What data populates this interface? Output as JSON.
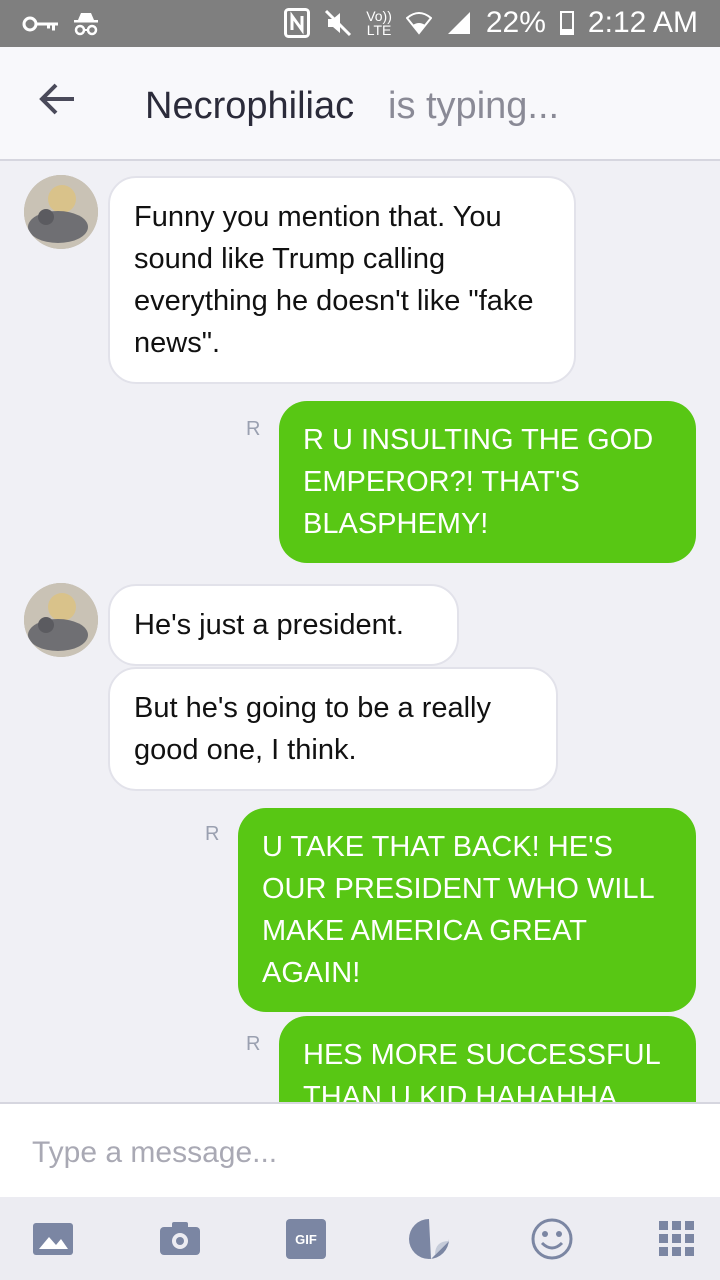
{
  "status_bar": {
    "vo_label": "Vo))",
    "lte_label": "LTE",
    "battery": "22%",
    "time": "2:12 AM"
  },
  "header": {
    "contact_name": "Necrophiliac",
    "typing_status": "is typing..."
  },
  "messages": [
    {
      "from": "them",
      "text": "Funny you mention that. You sound like Trump calling everything he doesn't like \"fake news\"."
    },
    {
      "from": "me",
      "text": "R U INSULTING THE GOD EMPEROR?! THAT'S BLASPHEMY!",
      "read_mark": "R"
    },
    {
      "from": "them",
      "text": "He's just a president."
    },
    {
      "from": "them",
      "text": "But he's going to be a really good one, I think."
    },
    {
      "from": "me",
      "text": "U TAKE THAT BACK! HE'S OUR PRESIDENT WHO WILL MAKE AMERICA GREAT AGAIN!",
      "read_mark": "R"
    },
    {
      "from": "me",
      "text": "HES MORE SUCCESSFUL THAN U KID HAHAHHA",
      "read_mark": "R"
    }
  ],
  "composer": {
    "placeholder": "Type a message...",
    "gif_label": "GIF"
  },
  "colors": {
    "outgoing_bubble": "#58c714",
    "status_bar": "#7f7f7f",
    "header_bg": "#f8f8fb"
  },
  "icons": [
    "key-icon",
    "incognito-icon",
    "nfc-icon",
    "mute-icon",
    "wifi-icon",
    "signal-icon",
    "battery-icon",
    "back-arrow-icon",
    "image-icon",
    "camera-icon",
    "gif-icon",
    "sticker-icon",
    "emoji-icon",
    "apps-grid-icon"
  ]
}
